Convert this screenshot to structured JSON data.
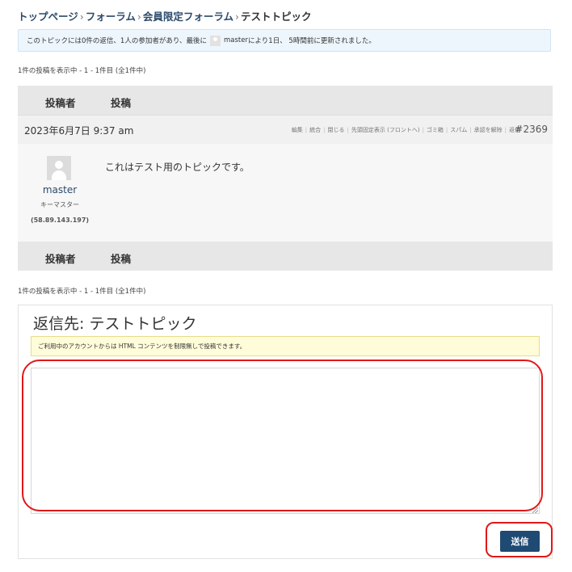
{
  "breadcrumb": {
    "items": [
      "トップページ",
      "フォーラム",
      "会員限定フォーラム"
    ],
    "separator": "›",
    "current": "テストトピック"
  },
  "topic_notice": {
    "text_before": "このトピックには0件の返信、1人の参加者があり、最後に",
    "user": "master",
    "text_after": "により1日、 5時間前に更新されました。"
  },
  "pagination": {
    "top": "1件の投稿を表示中 - 1 - 1件目 (全1件中)",
    "bottom": "1件の投稿を表示中 - 1 - 1件目 (全1件中)"
  },
  "table_header": {
    "author": "投稿者",
    "posts": "投稿"
  },
  "table_footer": {
    "author": "投稿者",
    "posts": "投稿"
  },
  "post": {
    "date": "2023年6月7日 9:37 am",
    "admin_links": [
      "編集",
      "統合",
      "閉じる",
      "先頭固定表示 (フロントへ)",
      "ゴミ箱",
      "スパム",
      "承認を解除",
      "返信"
    ],
    "id": "#2369",
    "author": {
      "name": "master",
      "role": "キーマスター",
      "ip": "(58.89.143.197)"
    },
    "content": "これはテスト用のトピックです。"
  },
  "reply": {
    "title": "返信先: テストトピック",
    "html_notice": "ご利用中のアカウントからは HTML コンテンツを制限無しで投稿できます。",
    "textarea_value": "",
    "submit_label": "送信"
  },
  "colors": {
    "link": "#2b4a6b",
    "submit": "#1f4a73",
    "highlight": "#e01818",
    "notice_bg": "#eef6fd",
    "warning_bg": "#fffcd9"
  }
}
